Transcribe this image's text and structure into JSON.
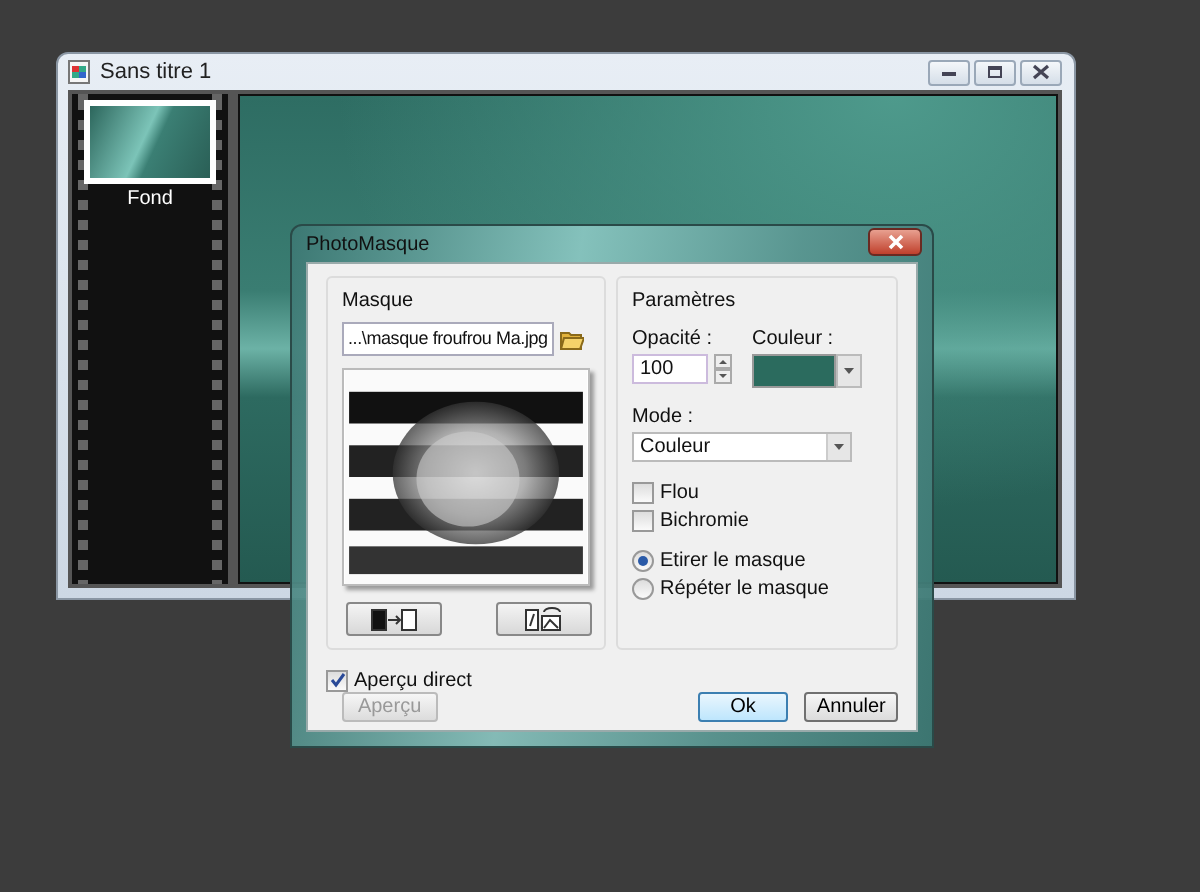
{
  "document_window": {
    "title": "Sans titre 1",
    "layers": [
      {
        "label": "Fond",
        "selected": true
      }
    ]
  },
  "dialog": {
    "title": "PhotoMasque",
    "mask_group": {
      "title": "Masque",
      "file_path": "...\\masque froufrou Ma.jpg"
    },
    "params_group": {
      "title": "Paramètres",
      "opacity_label": "Opacité :",
      "opacity_value": "100",
      "color_label": "Couleur :",
      "color": "#2b6b5e",
      "mode_label": "Mode :",
      "mode_value": "Couleur",
      "checkboxes": [
        {
          "label": "Flou",
          "checked": false
        },
        {
          "label": "Bichromie",
          "checked": false
        }
      ],
      "radios": [
        {
          "label": "Etirer le masque",
          "selected": true
        },
        {
          "label": "Répéter le masque",
          "selected": false
        }
      ]
    },
    "live_preview": {
      "label": "Aperçu direct",
      "checked": true
    },
    "buttons": [
      {
        "label": "Aperçu",
        "disabled": true,
        "default": false
      },
      {
        "label": "Ok",
        "disabled": false,
        "default": true
      },
      {
        "label": "Annuler",
        "disabled": false,
        "default": false
      }
    ]
  }
}
